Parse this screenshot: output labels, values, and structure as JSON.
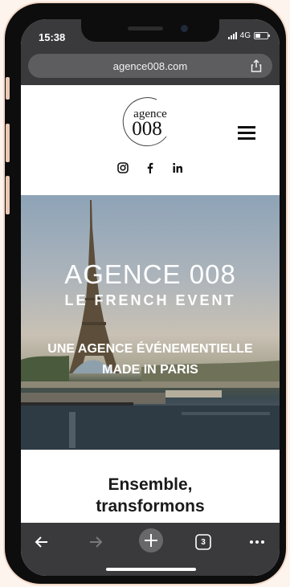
{
  "status_bar": {
    "time": "15:38",
    "network": "4G"
  },
  "browser": {
    "url": "agence008.com"
  },
  "site": {
    "logo": {
      "line1": "agence",
      "line2": "008"
    },
    "social_icons": [
      "instagram-icon",
      "facebook-icon",
      "linkedin-icon"
    ],
    "hero": {
      "title": "AGENCE 008",
      "subtitle": "LE FRENCH EVENT",
      "tagline_line1": "UNE AGENCE ÉVÉNEMENTIELLE",
      "tagline_line2": "MADE IN PARIS"
    },
    "section": {
      "heading_line1": "Ensemble,",
      "heading_line2": "transformons"
    }
  },
  "toolbar": {
    "tab_count": "3"
  },
  "colors": {
    "chrome": "#3a3a3c",
    "urlbar": "#5d5d60",
    "text_dark": "#1a1a1a"
  }
}
